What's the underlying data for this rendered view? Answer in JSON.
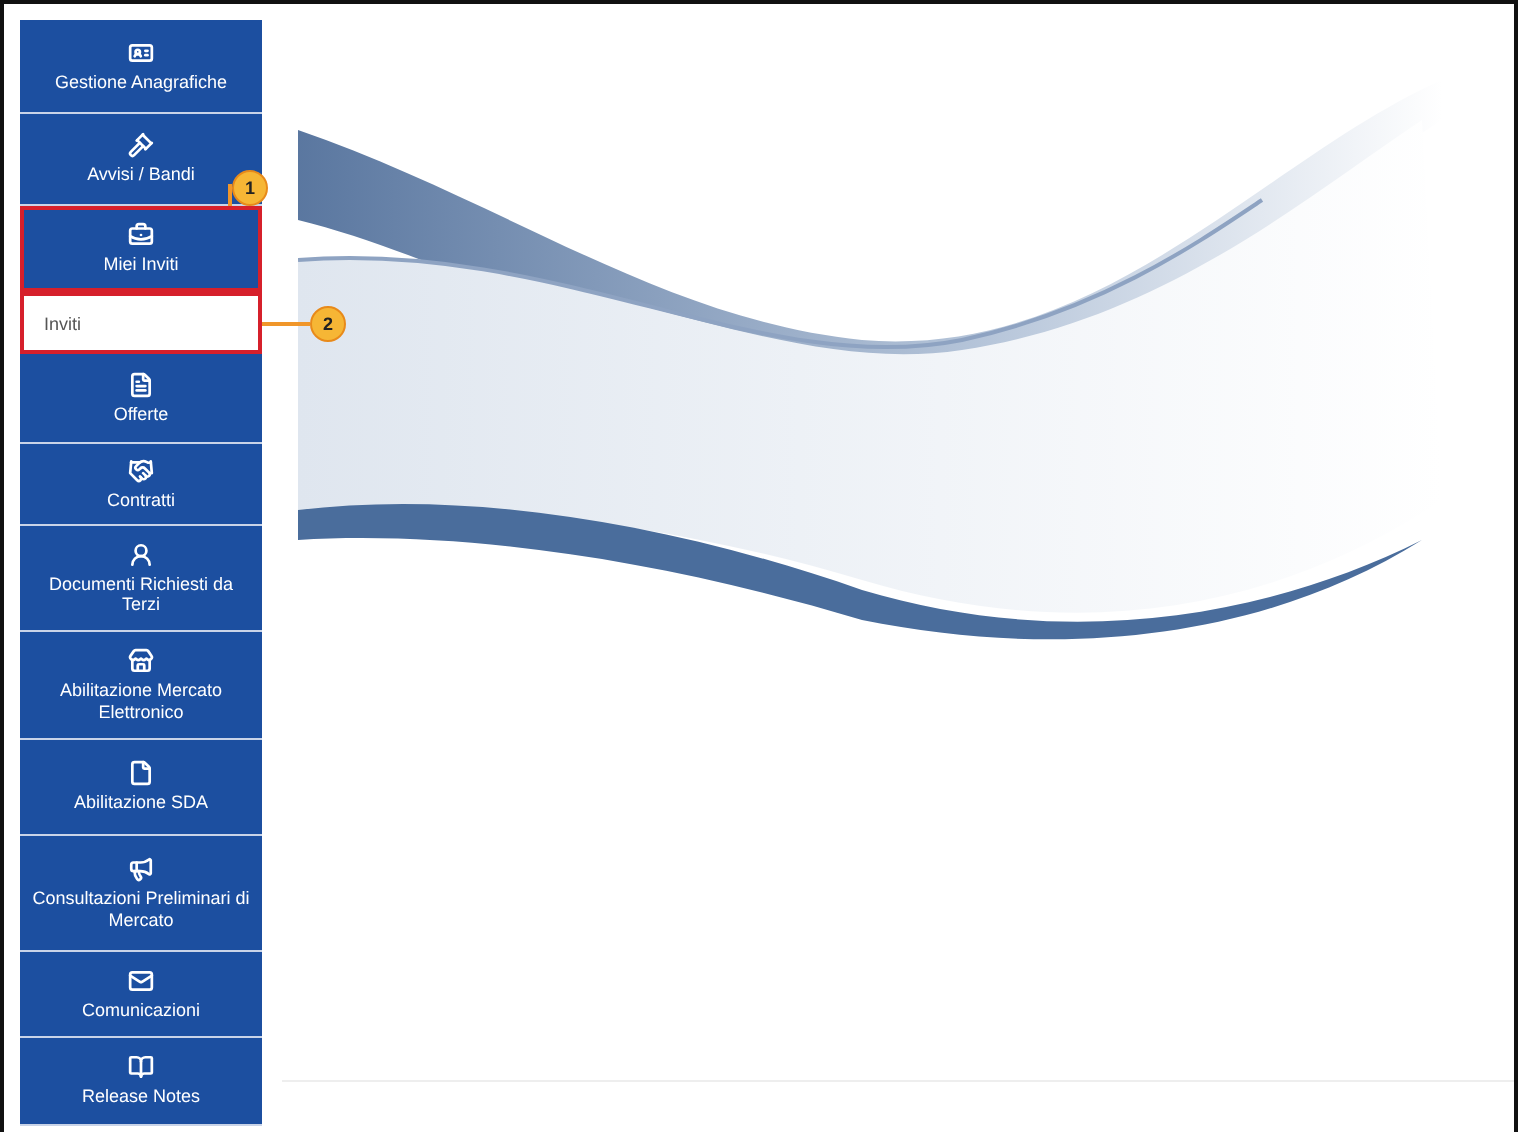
{
  "sidebar": {
    "items": [
      {
        "kind": "menu",
        "label": "Gestione Anagrafiche"
      },
      {
        "kind": "menu",
        "label": "Avvisi / Bandi"
      },
      {
        "kind": "menu",
        "label": "Miei Inviti",
        "callout": "1"
      },
      {
        "kind": "submenu",
        "label": "Inviti",
        "callout": "2"
      },
      {
        "kind": "menu",
        "label": "Offerte"
      },
      {
        "kind": "menu",
        "label": "Contratti"
      },
      {
        "kind": "menu",
        "label": "Documenti Richiesti da Terzi"
      },
      {
        "kind": "menu",
        "label": "Abilitazione Mercato Elettronico"
      },
      {
        "kind": "menu",
        "label": "Abilitazione SDA"
      },
      {
        "kind": "menu",
        "label": "Consultazioni Preliminari di Mercato"
      },
      {
        "kind": "menu",
        "label": "Comunicazioni"
      },
      {
        "kind": "menu",
        "label": "Release Notes"
      }
    ]
  }
}
